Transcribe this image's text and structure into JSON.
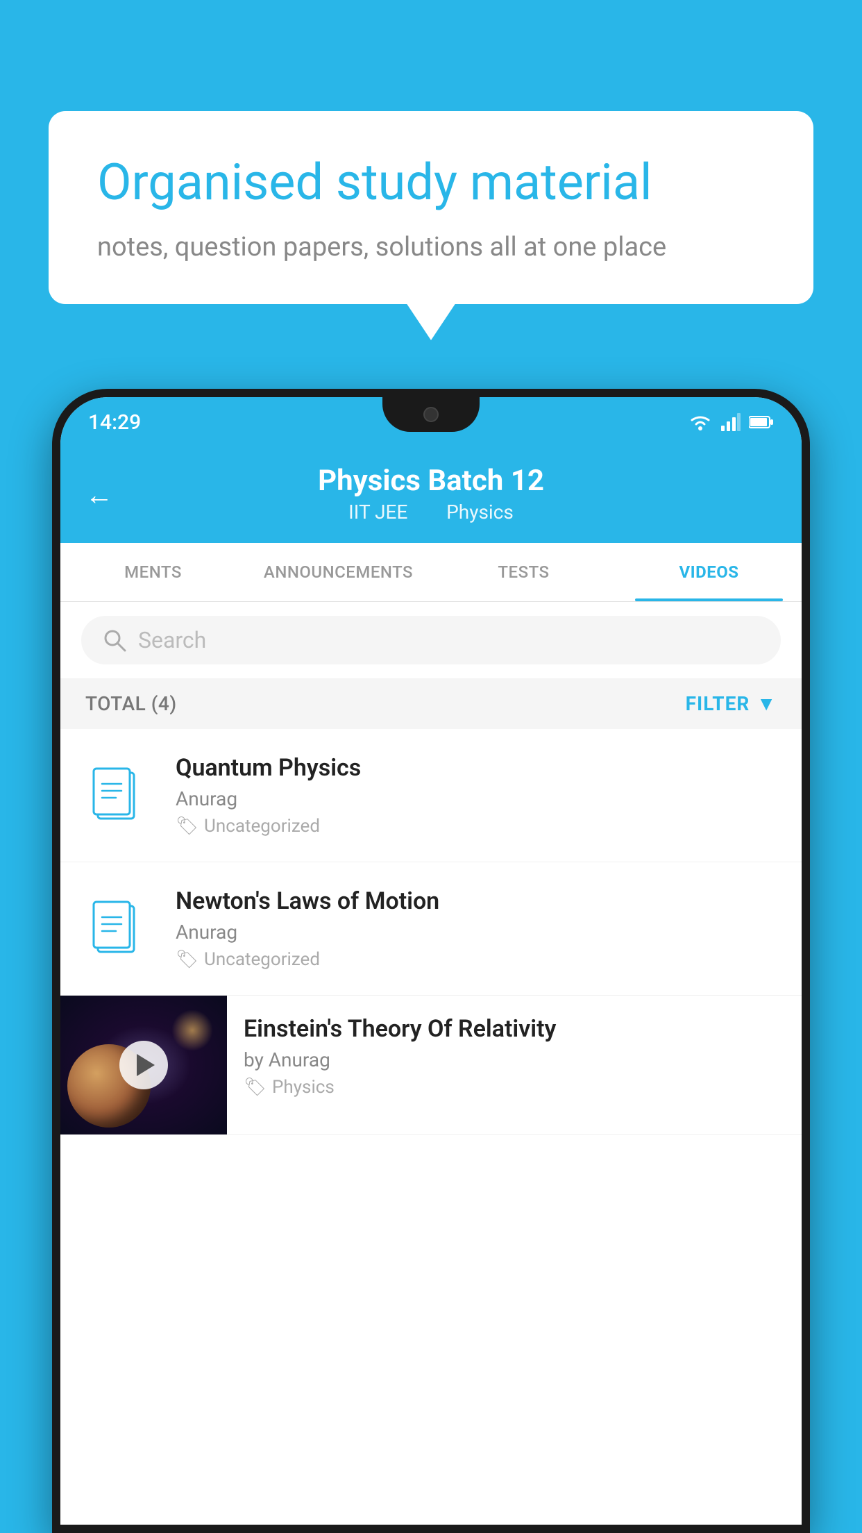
{
  "background_color": "#29B6E8",
  "speech_bubble": {
    "heading": "Organised study material",
    "subtext": "notes, question papers, solutions all at one place"
  },
  "status_bar": {
    "time": "14:29"
  },
  "app_header": {
    "title": "Physics Batch 12",
    "subtitle_part1": "IIT JEE",
    "subtitle_part2": "Physics",
    "back_label": "←"
  },
  "tabs": [
    {
      "label": "MENTS",
      "active": false
    },
    {
      "label": "ANNOUNCEMENTS",
      "active": false
    },
    {
      "label": "TESTS",
      "active": false
    },
    {
      "label": "VIDEOS",
      "active": true
    }
  ],
  "search": {
    "placeholder": "Search"
  },
  "filter_bar": {
    "total_label": "TOTAL (4)",
    "filter_label": "FILTER"
  },
  "videos": [
    {
      "title": "Quantum Physics",
      "author": "Anurag",
      "tag": "Uncategorized",
      "has_thumbnail": false
    },
    {
      "title": "Newton's Laws of Motion",
      "author": "Anurag",
      "tag": "Uncategorized",
      "has_thumbnail": false
    },
    {
      "title": "Einstein's Theory Of Relativity",
      "author": "by Anurag",
      "tag": "Physics",
      "has_thumbnail": true
    }
  ],
  "colors": {
    "accent": "#29B6E8",
    "text_primary": "#222222",
    "text_secondary": "#888888",
    "text_muted": "#aaaaaa"
  }
}
